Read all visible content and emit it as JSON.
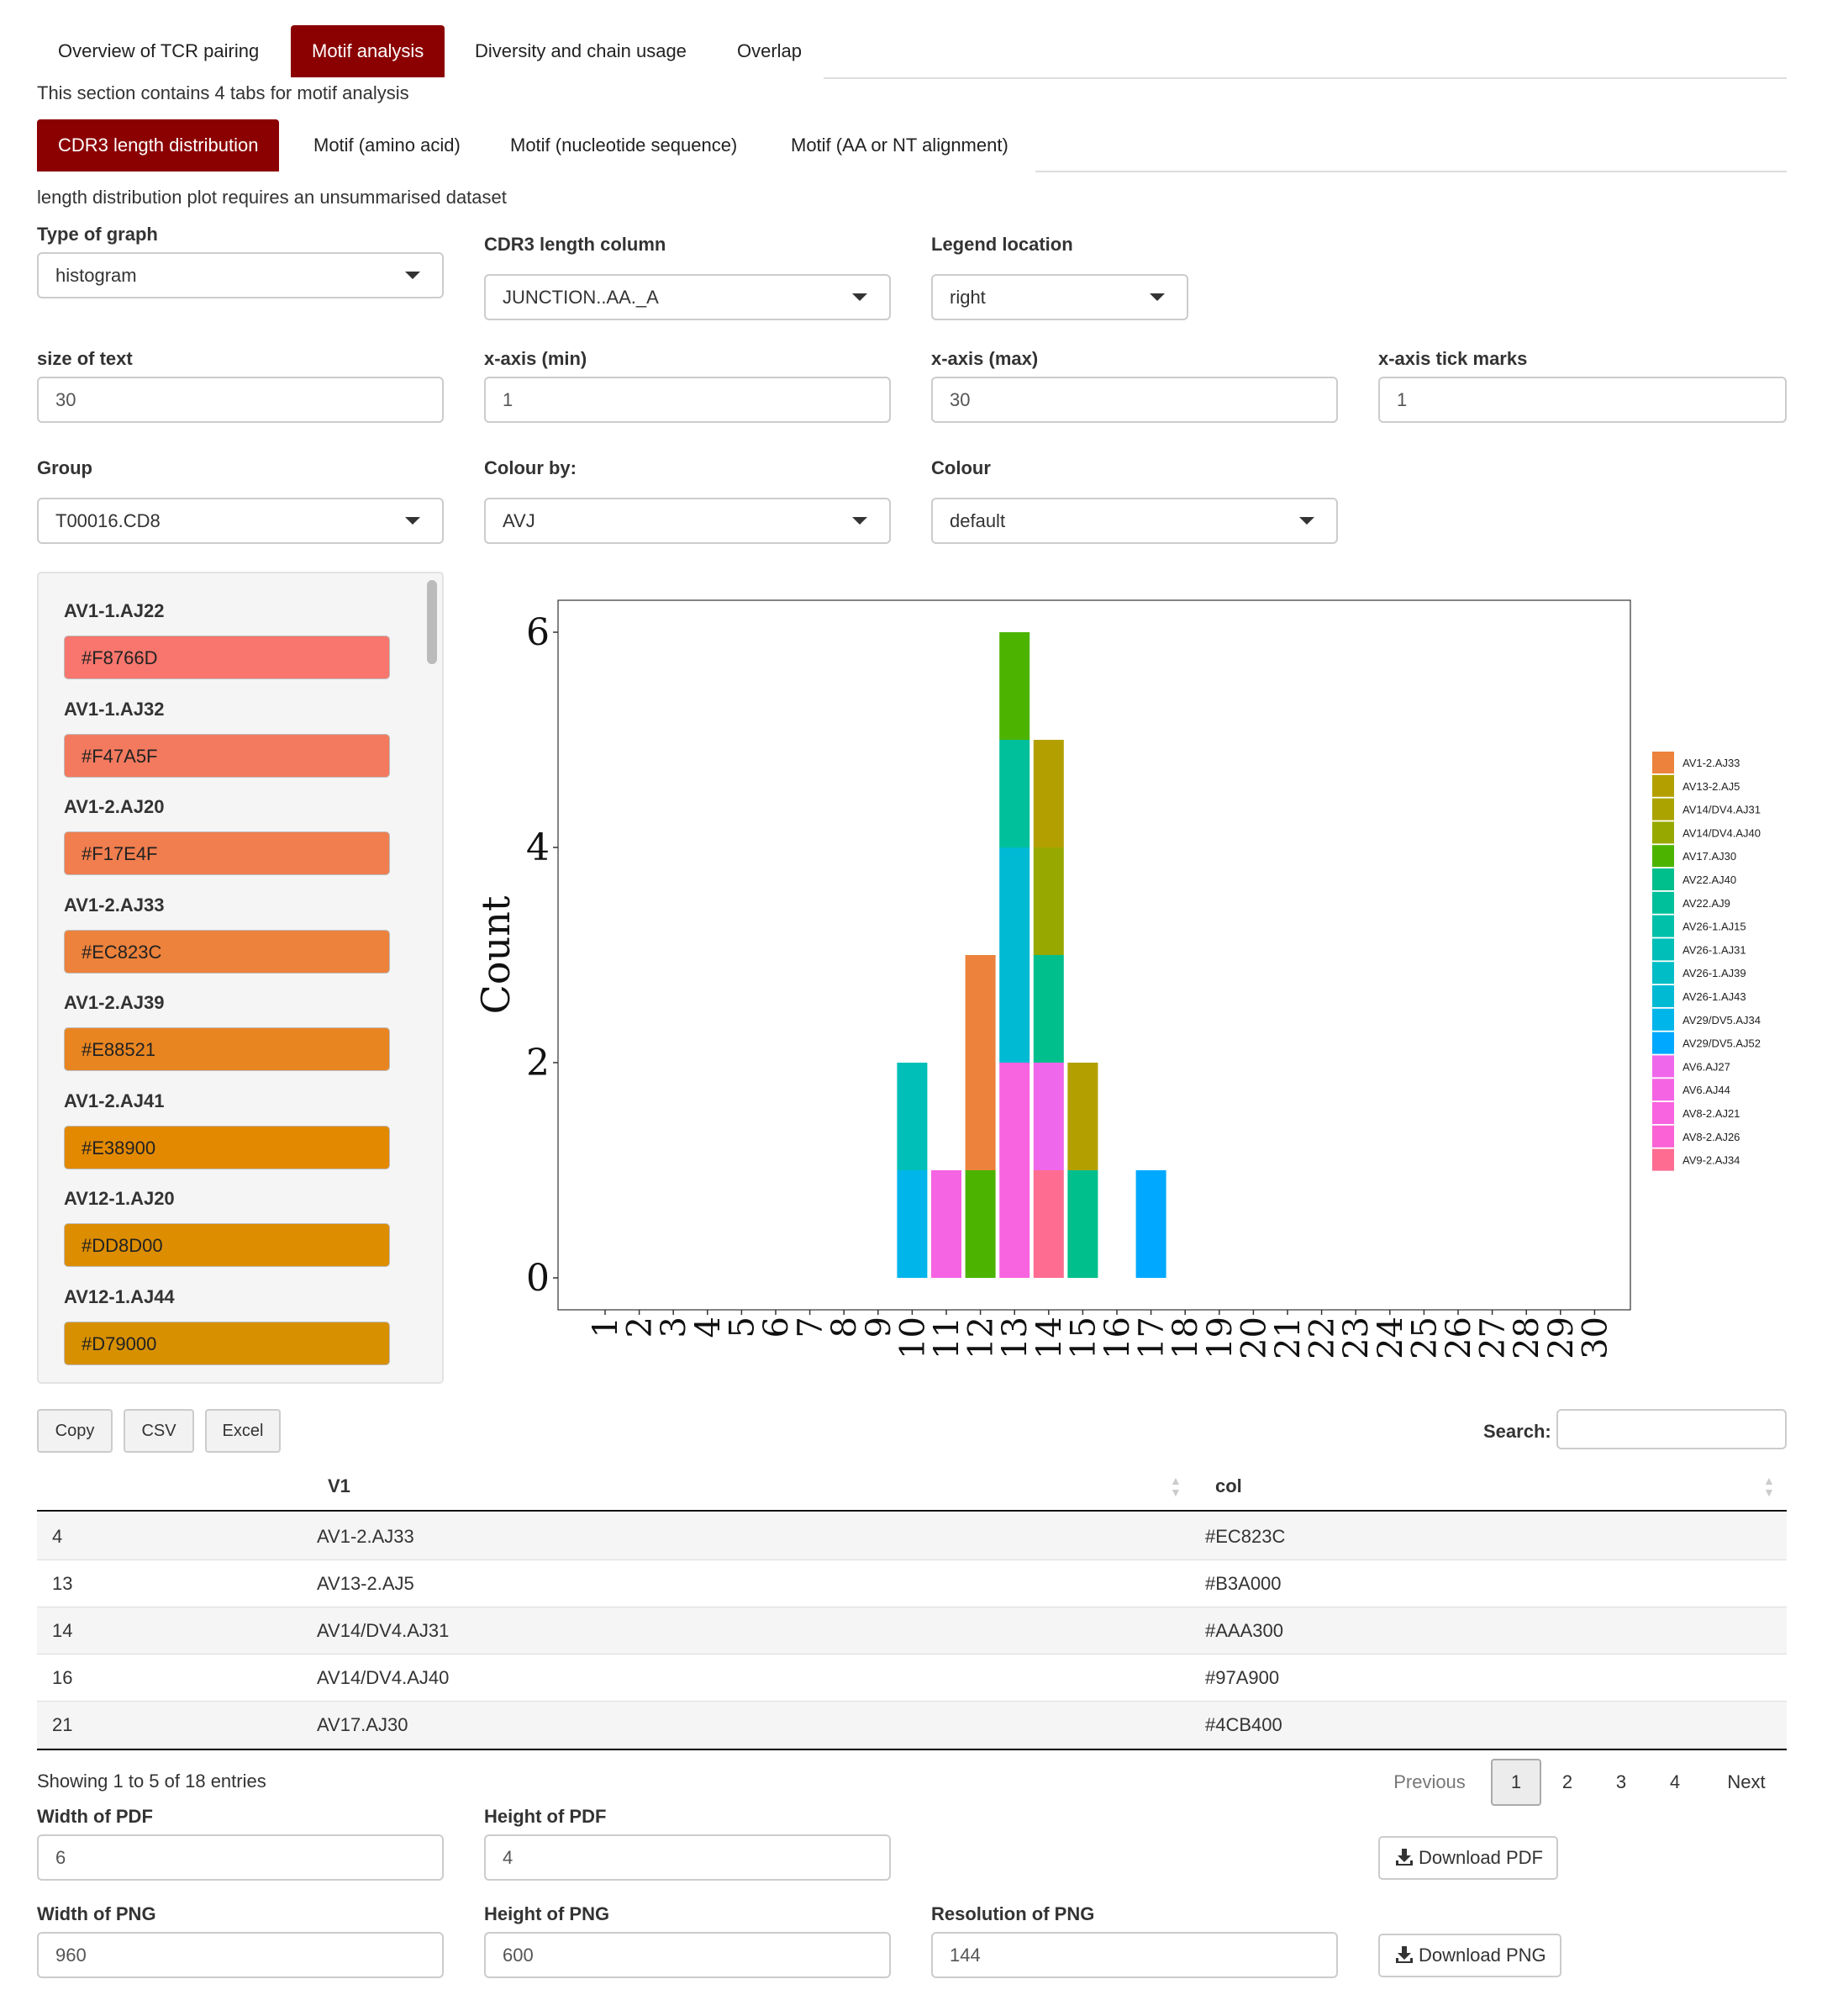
{
  "tabs": [
    "Overview of TCR pairing",
    "Motif analysis",
    "Diversity and chain usage",
    "Overlap"
  ],
  "section_desc": "This section contains 4 tabs for motif analysis",
  "subtabs": [
    "CDR3 length distribution",
    "Motif (amino acid)",
    "Motif (nucleotide sequence)",
    "Motif (AA or NT alignment)"
  ],
  "note": "length distribution plot requires an unsummarised dataset",
  "controls": {
    "type_label": "Type of graph",
    "type_value": "histogram",
    "cdr3_label": "CDR3 length column",
    "cdr3_value": "JUNCTION..AA._A",
    "legend_label": "Legend location",
    "legend_value": "right",
    "textsize_label": "size of text",
    "textsize_value": "30",
    "xmin_label": "x-axis (min)",
    "xmin_value": "1",
    "xmax_label": "x-axis (max)",
    "xmax_value": "30",
    "xtick_label": "x-axis tick marks",
    "xtick_value": "1",
    "group_label": "Group",
    "group_value": "T00016.CD8",
    "colourby_label": "Colour by:",
    "colourby_value": "AVJ",
    "colour_label": "Colour",
    "colour_value": "default"
  },
  "colour_inputs": [
    {
      "label": "AV1-1.AJ22",
      "value": "#F8766D"
    },
    {
      "label": "AV1-1.AJ32",
      "value": "#F47A5F"
    },
    {
      "label": "AV1-2.AJ20",
      "value": "#F17E4F"
    },
    {
      "label": "AV1-2.AJ33",
      "value": "#EC823C"
    },
    {
      "label": "AV1-2.AJ39",
      "value": "#E88521"
    },
    {
      "label": "AV1-2.AJ41",
      "value": "#E38900"
    },
    {
      "label": "AV12-1.AJ20",
      "value": "#DD8D00"
    },
    {
      "label": "AV12-1.AJ44",
      "value": "#D79000"
    }
  ],
  "chart_data": {
    "type": "bar",
    "stacked": true,
    "ylabel": "Count",
    "yticks": [
      "0",
      "2",
      "4",
      "6"
    ],
    "ylim": [
      0,
      6.3
    ],
    "xlim": [
      1,
      30
    ],
    "xticks": [
      "1",
      "2",
      "3",
      "4",
      "5",
      "6",
      "7",
      "8",
      "9",
      "10",
      "11",
      "12",
      "13",
      "14",
      "15",
      "16",
      "17",
      "18",
      "19",
      "20",
      "21",
      "22",
      "23",
      "24",
      "25",
      "26",
      "27",
      "28",
      "29",
      "30"
    ],
    "legend_position": "right",
    "legend": [
      {
        "name": "AV1-2.AJ33",
        "color": "#EC823C"
      },
      {
        "name": "AV13-2.AJ5",
        "color": "#B3A000"
      },
      {
        "name": "AV14/DV4.AJ31",
        "color": "#AAA300"
      },
      {
        "name": "AV14/DV4.AJ40",
        "color": "#97A900"
      },
      {
        "name": "AV17.AJ30",
        "color": "#4CB400"
      },
      {
        "name": "AV22.AJ40",
        "color": "#00BF8C"
      },
      {
        "name": "AV22.AJ9",
        "color": "#00C09B"
      },
      {
        "name": "AV26-1.AJ15",
        "color": "#00C0AA"
      },
      {
        "name": "AV26-1.AJ31",
        "color": "#00BFB8"
      },
      {
        "name": "AV26-1.AJ39",
        "color": "#00BDC6"
      },
      {
        "name": "AV26-1.AJ43",
        "color": "#00BAD4"
      },
      {
        "name": "AV29/DV5.AJ34",
        "color": "#00B5EA"
      },
      {
        "name": "AV29/DV5.AJ52",
        "color": "#00A9FF"
      },
      {
        "name": "AV6.AJ27",
        "color": "#EF67EB"
      },
      {
        "name": "AV6.AJ44",
        "color": "#F564E3"
      },
      {
        "name": "AV8-2.AJ21",
        "color": "#F863DF"
      },
      {
        "name": "AV8-2.AJ26",
        "color": "#FA62D5"
      },
      {
        "name": "AV9-2.AJ34",
        "color": "#FF6C91"
      }
    ],
    "bars": [
      {
        "x": 10,
        "segments": [
          {
            "series": "AV29/DV5.AJ34",
            "value": 1
          },
          {
            "series": "AV26-1.AJ31",
            "value": 1
          }
        ]
      },
      {
        "x": 11,
        "segments": [
          {
            "series": "AV6.AJ44",
            "value": 1
          }
        ]
      },
      {
        "x": 12,
        "segments": [
          {
            "series": "AV17.AJ30",
            "value": 1
          },
          {
            "series": "AV1-2.AJ33",
            "value": 2
          }
        ]
      },
      {
        "x": 13,
        "segments": [
          {
            "series": "AV8-2.AJ21",
            "value": 2
          },
          {
            "series": "AV26-1.AJ43",
            "value": 2
          },
          {
            "series": "AV22.AJ9",
            "value": 1
          },
          {
            "series": "AV17.AJ30",
            "value": 1
          }
        ]
      },
      {
        "x": 14,
        "segments": [
          {
            "series": "AV9-2.AJ34",
            "value": 1
          },
          {
            "series": "AV6.AJ27",
            "value": 1
          },
          {
            "series": "AV22.AJ40",
            "value": 1
          },
          {
            "series": "AV14/DV4.AJ40",
            "value": 1
          },
          {
            "series": "AV13-2.AJ5",
            "value": 1
          }
        ]
      },
      {
        "x": 15,
        "segments": [
          {
            "series": "AV22.AJ40",
            "value": 1
          },
          {
            "series": "AV13-2.AJ5",
            "value": 1
          }
        ]
      },
      {
        "x": 17,
        "segments": [
          {
            "series": "AV29/DV5.AJ52",
            "value": 1
          }
        ]
      }
    ]
  },
  "table": {
    "buttons": [
      "Copy",
      "CSV",
      "Excel"
    ],
    "search_label": "Search:",
    "columns": [
      "",
      "V1",
      "col"
    ],
    "rows": [
      [
        "4",
        "AV1-2.AJ33",
        "#EC823C"
      ],
      [
        "13",
        "AV13-2.AJ5",
        "#B3A000"
      ],
      [
        "14",
        "AV14/DV4.AJ31",
        "#AAA300"
      ],
      [
        "16",
        "AV14/DV4.AJ40",
        "#97A900"
      ],
      [
        "21",
        "AV17.AJ30",
        "#4CB400"
      ]
    ],
    "info": "Showing 1 to 5 of 18 entries",
    "pagination": [
      "Previous",
      "1",
      "2",
      "3",
      "4",
      "Next"
    ]
  },
  "export": {
    "pdf_w_label": "Width of PDF",
    "pdf_w_value": "6",
    "pdf_h_label": "Height of PDF",
    "pdf_h_value": "4",
    "pdf_button": "Download PDF",
    "png_w_label": "Width of PNG",
    "png_w_value": "960",
    "png_h_label": "Height of PNG",
    "png_h_value": "600",
    "png_res_label": "Resolution of PNG",
    "png_res_value": "144",
    "png_button": "Download PNG"
  }
}
